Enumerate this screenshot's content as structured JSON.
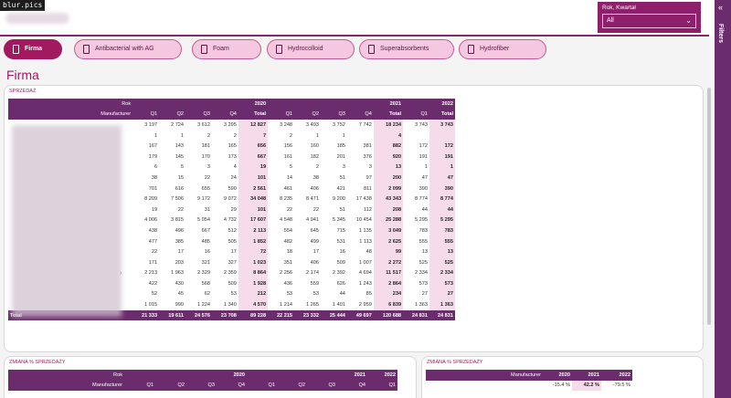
{
  "watermark": "blur.pics",
  "slicer": {
    "label": "Rok, Kwartał",
    "value": "All"
  },
  "filters_label": "Filters",
  "tabs": [
    {
      "label": "Firma",
      "active": true
    },
    {
      "label": "Antibacterial with AG",
      "active": false
    },
    {
      "label": "Foam",
      "active": false
    },
    {
      "label": "Hydrocolloid",
      "active": false
    },
    {
      "label": "Superabsorbents",
      "active": false
    },
    {
      "label": "Hydrofiber",
      "active": false
    }
  ],
  "page_title": "Firma",
  "sales": {
    "title": "SPRZEDAŻ",
    "row_header_rok": "Rok",
    "row_header_mfr": "Manufacturer",
    "years": [
      "2020",
      "2021",
      "2022"
    ],
    "columns": [
      "Q1",
      "Q2",
      "Q3",
      "Q4",
      "Total",
      "Q1",
      "Q2",
      "Q3",
      "Q4",
      "Total",
      "Q1",
      "Total"
    ],
    "rows": [
      [
        "3 197",
        "2 724",
        "3 612",
        "3 295",
        "12 827",
        "3 248",
        "3 493",
        "3 752",
        "7 742",
        "18 234",
        "3 743",
        "3 743"
      ],
      [
        "1",
        "1",
        "2",
        "2",
        "7",
        "2",
        "1",
        "1",
        "",
        "4",
        "",
        ""
      ],
      [
        "167",
        "143",
        "181",
        "165",
        "656",
        "156",
        "160",
        "185",
        "381",
        "882",
        "172",
        "172"
      ],
      [
        "179",
        "145",
        "170",
        "173",
        "667",
        "161",
        "182",
        "201",
        "376",
        "920",
        "191",
        "191"
      ],
      [
        "6",
        "5",
        "3",
        "4",
        "19",
        "5",
        "2",
        "3",
        "3",
        "13",
        "1",
        "1"
      ],
      [
        "38",
        "15",
        "22",
        "24",
        "101",
        "14",
        "38",
        "51",
        "97",
        "200",
        "47",
        "47"
      ],
      [
        "701",
        "616",
        "655",
        "590",
        "2 561",
        "461",
        "406",
        "421",
        "811",
        "2 099",
        "390",
        "390"
      ],
      [
        "8 209",
        "7 506",
        "9 172",
        "9 072",
        "34 048",
        "8 235",
        "8 471",
        "9 200",
        "17 438",
        "43 343",
        "8 774",
        "8 774"
      ],
      [
        "19",
        "22",
        "31",
        "29",
        "101",
        "22",
        "22",
        "51",
        "112",
        "208",
        "44",
        "44"
      ],
      [
        "4 006",
        "3 815",
        "5 054",
        "4 732",
        "17 607",
        "4 548",
        "4 941",
        "5 345",
        "10 454",
        "25 288",
        "5 295",
        "5 295"
      ],
      [
        "438",
        "496",
        "667",
        "512",
        "2 113",
        "554",
        "645",
        "715",
        "1 135",
        "3 049",
        "783",
        "783"
      ],
      [
        "477",
        "385",
        "485",
        "505",
        "1 852",
        "482",
        "499",
        "531",
        "1 113",
        "2 625",
        "555",
        "555"
      ],
      [
        "22",
        "17",
        "16",
        "17",
        "72",
        "18",
        "17",
        "16",
        "48",
        "99",
        "13",
        "13"
      ],
      [
        "171",
        "203",
        "321",
        "327",
        "1 023",
        "351",
        "406",
        "509",
        "1 007",
        "2 272",
        "525",
        "525"
      ],
      [
        "2 213",
        "1 963",
        "2 329",
        "2 359",
        "8 864",
        "2 256",
        "2 174",
        "2 392",
        "4 694",
        "11 517",
        "2 334",
        "2 334"
      ],
      [
        "422",
        "430",
        "568",
        "509",
        "1 928",
        "436",
        "559",
        "626",
        "1 243",
        "2 864",
        "573",
        "573"
      ],
      [
        "52",
        "45",
        "62",
        "53",
        "212",
        "53",
        "53",
        "44",
        "85",
        "234",
        "27",
        "27"
      ],
      [
        "1 015",
        "990",
        "1 224",
        "1 340",
        "4 570",
        "1 214",
        "1 265",
        "1 401",
        "2 959",
        "6 839",
        "1 363",
        "1 363"
      ]
    ],
    "total_label": "Total",
    "totals": [
      "21 333",
      "19 611",
      "24 576",
      "23 708",
      "89 228",
      "22 215",
      "23 332",
      "25 444",
      "49 697",
      "120 688",
      "24 831",
      "24 831"
    ]
  },
  "change": {
    "title": "ZMIANA % SPRZEDAŻY",
    "row_header_rok": "Rok",
    "row_header_mfr": "Manufacturer",
    "years": [
      "2020",
      "2021",
      "2022"
    ],
    "columns": [
      "Q1",
      "Q2",
      "Q3",
      "Q4",
      "Q1",
      "Q2",
      "Q3",
      "Q4",
      "Q1"
    ]
  },
  "change_yearly": {
    "title": "ZMIANA % SPRZEDAŻY",
    "header_mfr": "Manufacturer",
    "years": [
      "2020",
      "2021",
      "2022"
    ],
    "values": [
      "-15.4 %",
      "42.2 %",
      "-79.5 %"
    ]
  },
  "colors": {
    "accent": "#8e1f6b",
    "header_purple": "#6b2c6d",
    "tab_active": "#a3195f",
    "tab_pink": "#f5c8df",
    "total_cell": "#f6dcea"
  }
}
